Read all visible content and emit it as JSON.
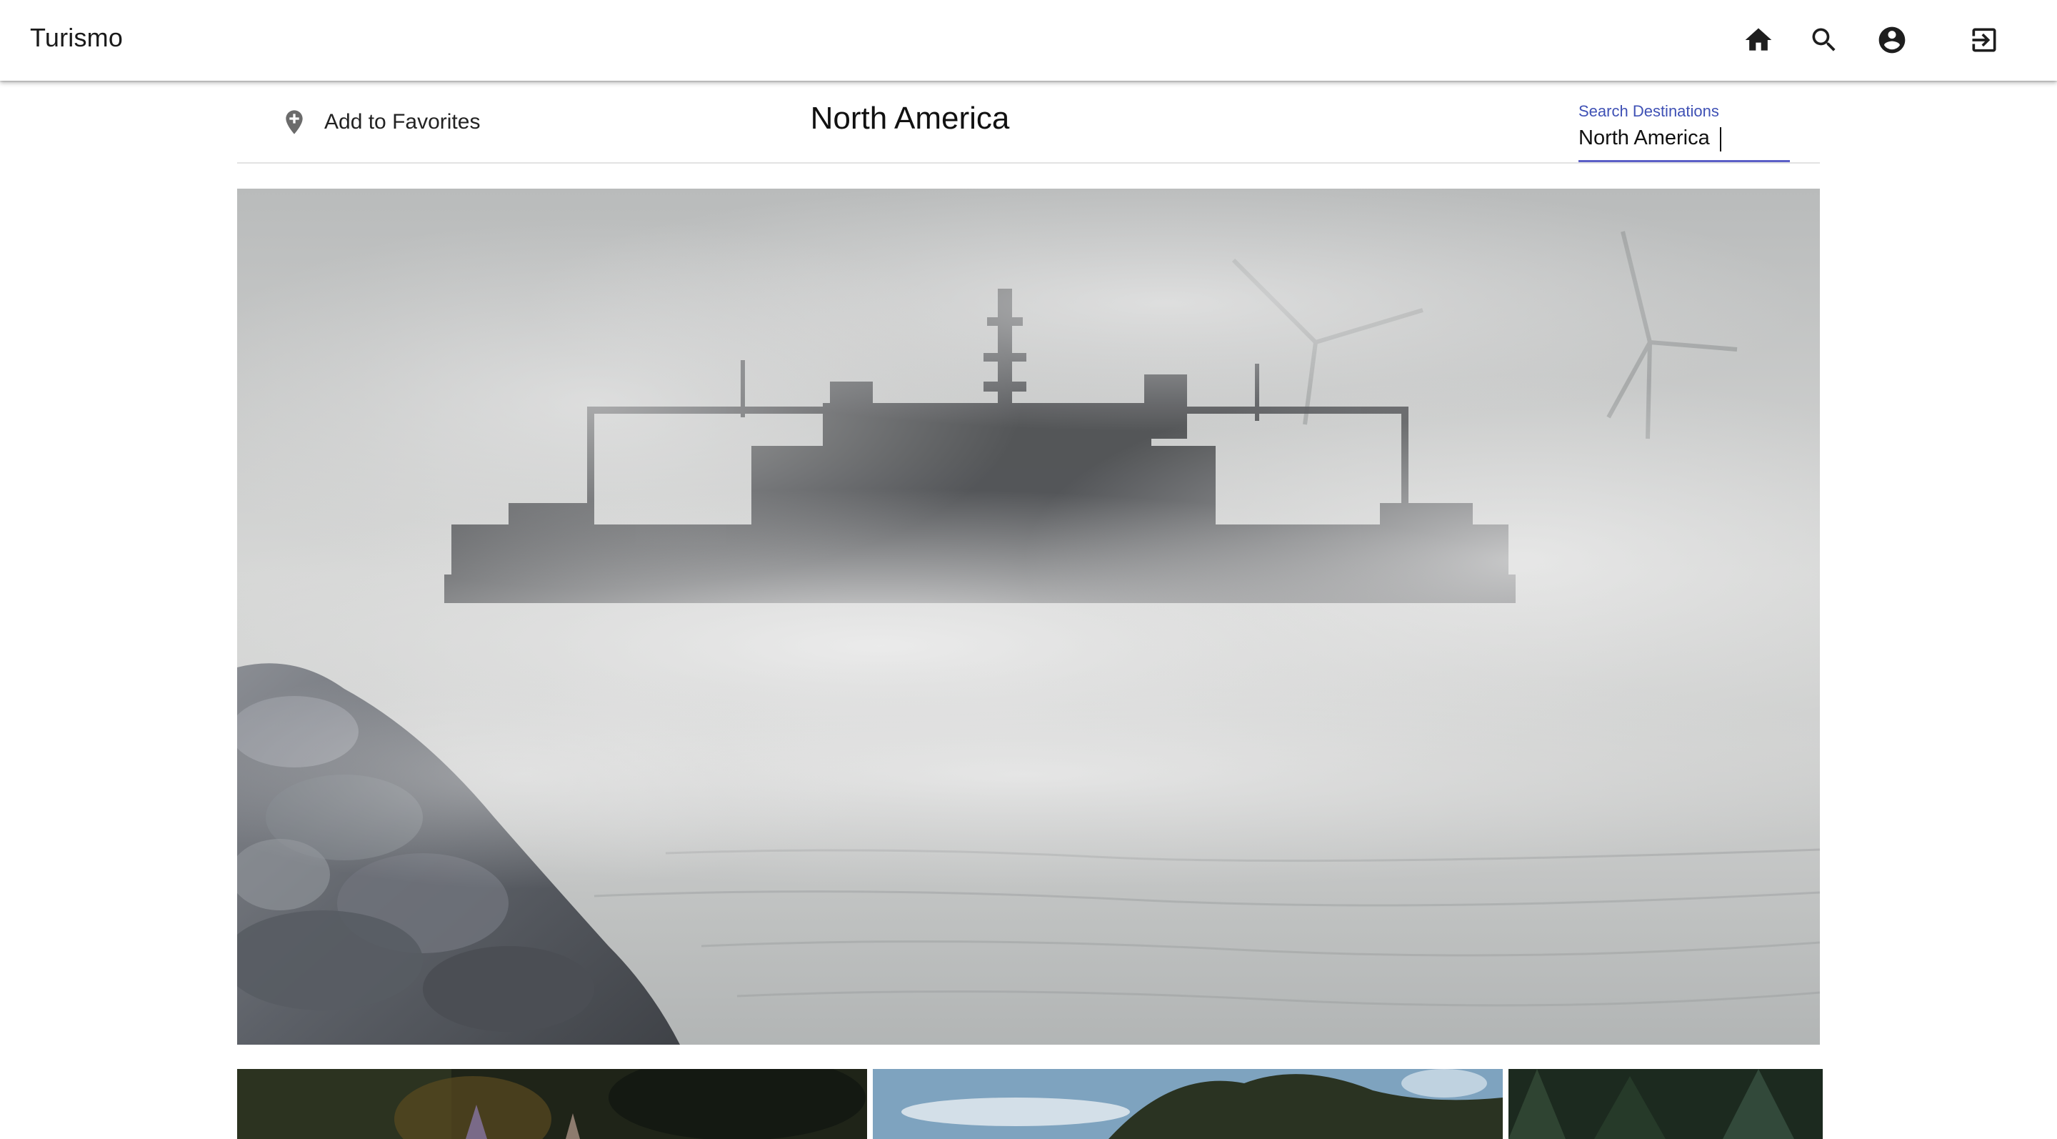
{
  "app": {
    "brand": "Turismo"
  },
  "nav": {
    "home_icon": "home-icon",
    "search_icon": "search-icon",
    "account_icon": "account-circle-icon",
    "logout_icon": "logout-icon"
  },
  "subheader": {
    "favorite_label": "Add to Favorites",
    "favorite_icon": "add-location-icon",
    "title": "North America"
  },
  "search": {
    "label": "Search Destinations",
    "value": "North America",
    "accent_color": "#3f51b5"
  },
  "hero": {
    "subject": "ferry in sea smoke"
  },
  "thumbnails": [
    {
      "subject": "dark forest"
    },
    {
      "subject": "trees and sky"
    },
    {
      "subject": "pine forest"
    }
  ]
}
